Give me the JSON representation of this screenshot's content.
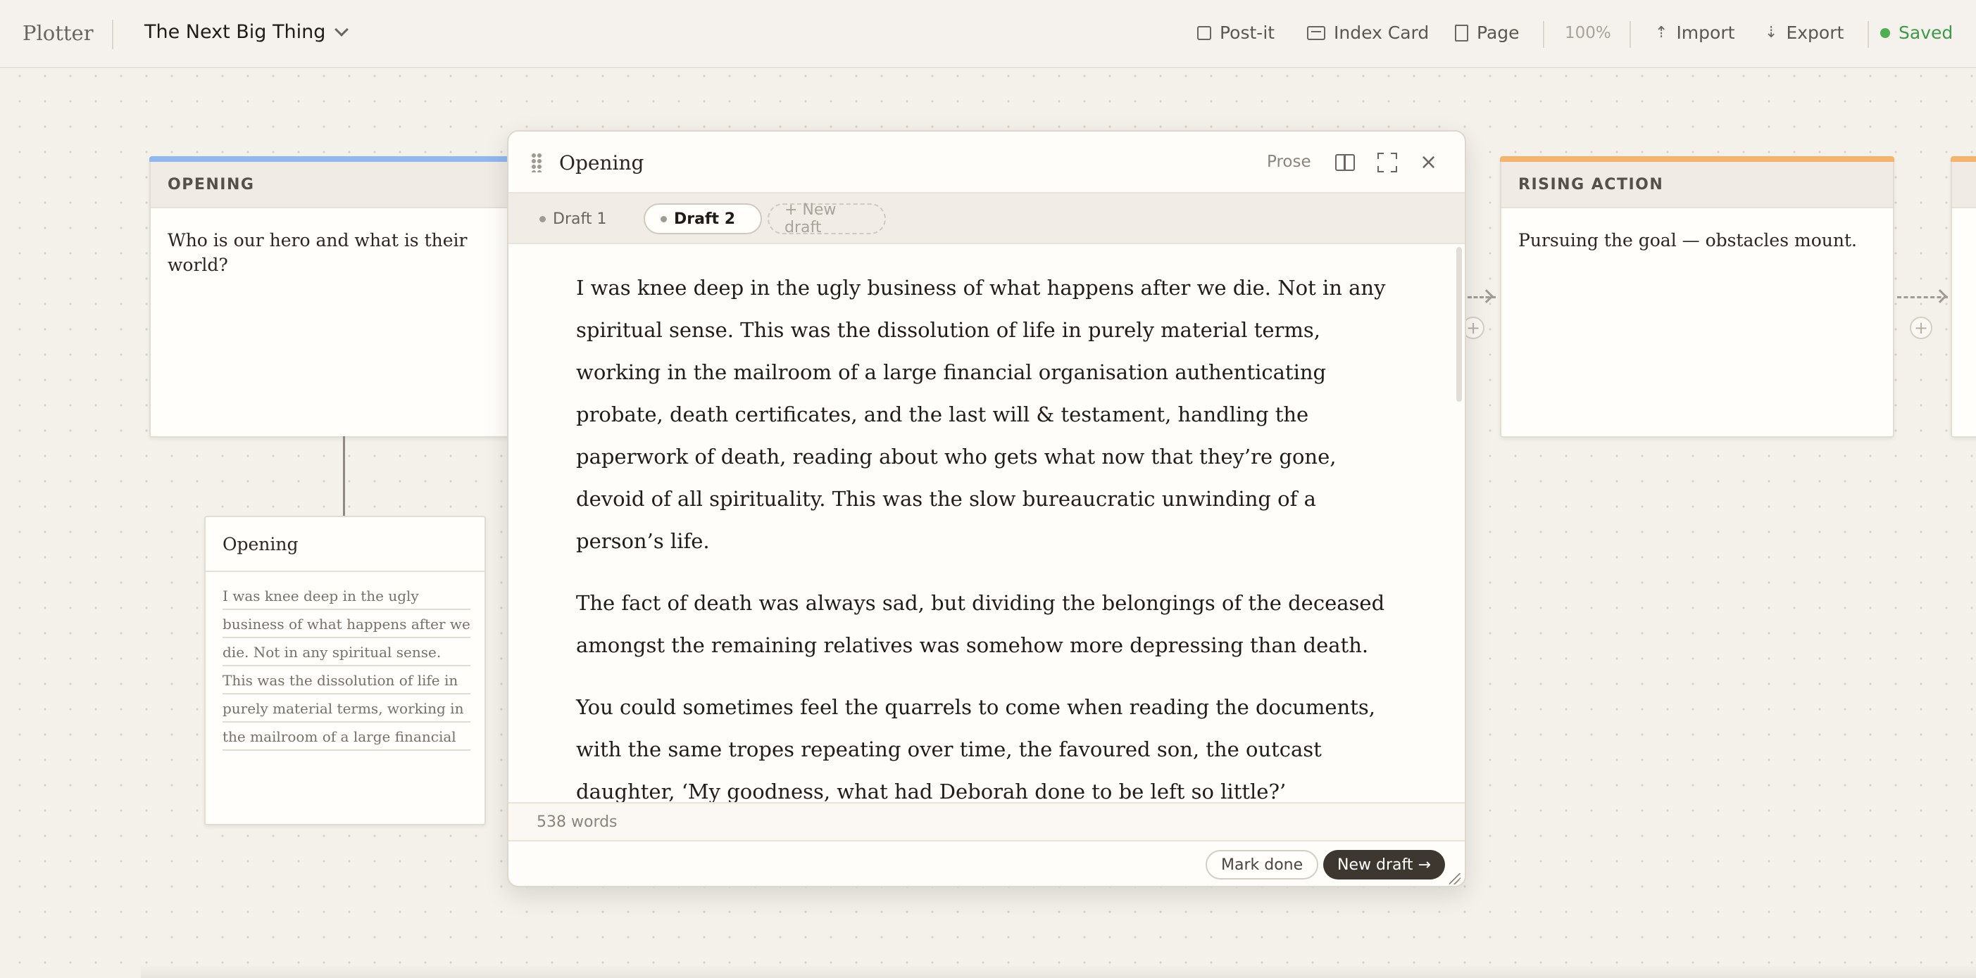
{
  "app": {
    "brand": "Plotter",
    "project_title": "The Next Big Thing"
  },
  "toolbar": {
    "postit_label": "Post-it",
    "index_card_label": "Index Card",
    "page_label": "Page",
    "zoom": "100%",
    "import_label": "Import",
    "export_label": "Export",
    "status": "Saved",
    "status_color": "#4caf50"
  },
  "acts": [
    {
      "header": "OPENING",
      "body": "Who is our hero and what is their world?",
      "color": "#8fb8ee"
    },
    {
      "header": "RISING ACTION",
      "body": "Pursuing the goal — obstacles mount.",
      "color": "#f4b46c"
    }
  ],
  "scene": {
    "title": "Opening",
    "excerpt": "I was knee deep in the ugly business of what happens after we die. Not in any spiritual sense. This was the dissolution of life in purely material terms, working in the mailroom of a large financial organisation authenticating probate, death"
  },
  "editor": {
    "title": "Opening",
    "mode": "Prose",
    "drafts": [
      "Draft 1",
      "Draft 2"
    ],
    "new_draft_tab": "+ New draft",
    "paragraphs": [
      "I was knee deep in the ugly business of what happens after we die. Not in any spiritual sense. This was the dissolution of life in purely material terms, working in the mailroom of a large financial organisation authenticating probate, death certificates, and the last will & testament, handling the paperwork of death, reading about who gets what now that they’re gone, devoid of all spirituality. This was the slow bureaucratic unwinding of a person’s life.",
      "The fact of death was always sad, but dividing the belongings of the deceased amongst the remaining relatives was somehow more depressing than death.",
      "You could sometimes feel the quarrels to come when reading the documents, with the same tropes repeating over time, the favoured son, the outcast daughter, ‘My goodness, what had Deborah done to be left so little?’"
    ],
    "word_count": "538 words",
    "mark_done": "Mark done",
    "new_draft_button": "New draft →"
  },
  "icons": {
    "close": "×",
    "plus": "+"
  }
}
